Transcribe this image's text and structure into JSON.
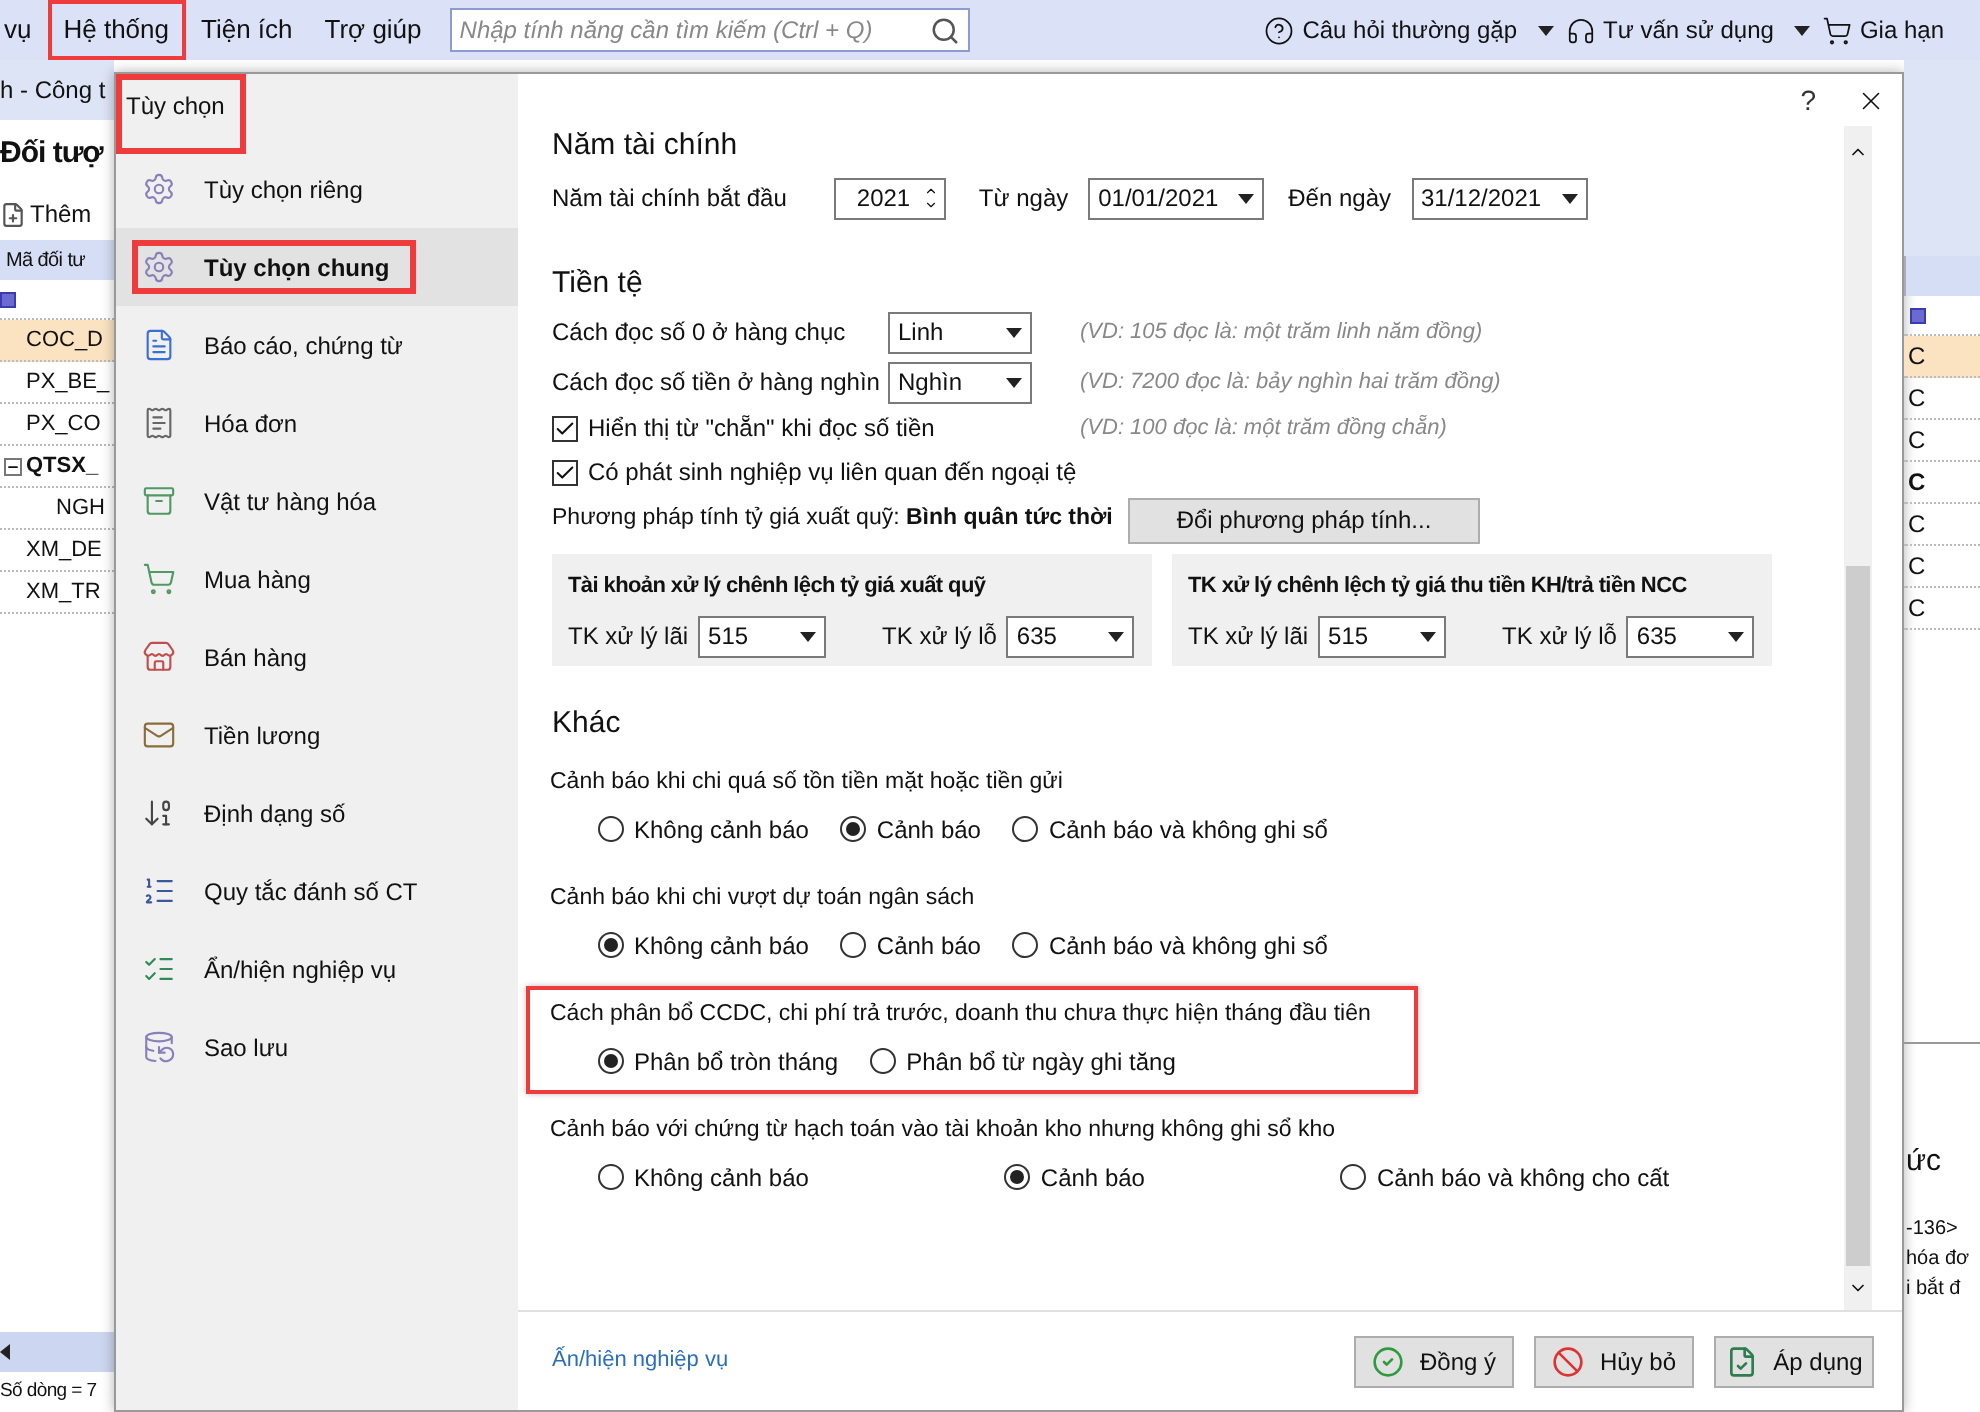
{
  "menubar": {
    "items": [
      {
        "label": "vụ",
        "highlighted": false
      },
      {
        "label": "Hệ thống",
        "highlighted": true
      },
      {
        "label": "Tiện ích",
        "highlighted": false
      },
      {
        "label": "Trợ giúp",
        "highlighted": false
      }
    ],
    "search": {
      "placeholder": "Nhập tính năng cần tìm kiếm (Ctrl + Q)"
    },
    "right_items": [
      {
        "label": "Câu hỏi thường gặp",
        "has_menu": true
      },
      {
        "label": "Tư vấn sử dụng",
        "has_menu": true
      },
      {
        "label": "Gia hạn",
        "has_menu": false
      }
    ]
  },
  "background_left": {
    "breadcrumb": "h - Công t",
    "title": "Đối tượ",
    "add_button": "Thêm",
    "column": "Mã đối tư",
    "rows": [
      {
        "text": "COC_D",
        "selected": true
      },
      {
        "text": "PX_BE_",
        "selected": false
      },
      {
        "text": "PX_CO",
        "selected": false
      },
      {
        "text": "QTSX_",
        "selected": false,
        "expanded": true,
        "children": [
          {
            "text": "NGH",
            "selected": false
          }
        ]
      },
      {
        "text": "XM_DE",
        "selected": false
      },
      {
        "text": "XM_TR",
        "selected": false
      }
    ],
    "row_count": "Số dòng = 7"
  },
  "background_right": {
    "rows": [
      {
        "text": "C",
        "selected": true,
        "kind": "item"
      },
      {
        "text": "C",
        "selected": false,
        "kind": "item"
      },
      {
        "text": "C",
        "selected": false,
        "kind": "item"
      },
      {
        "text": "C",
        "selected": false,
        "kind": "group"
      },
      {
        "text": "C",
        "selected": false,
        "kind": "item"
      },
      {
        "text": "C",
        "selected": false,
        "kind": "item"
      },
      {
        "text": "C",
        "selected": false,
        "kind": "item"
      }
    ],
    "heading": "ức",
    "lines": [
      "-136>",
      "hóa đơ",
      "i bắt đ"
    ]
  },
  "dialog": {
    "title": "Tùy chọn",
    "title_highlighted": true,
    "help": "?",
    "nav": [
      {
        "label": "Tùy chọn riêng",
        "selected": false,
        "highlighted": false
      },
      {
        "label": "Tùy chọn chung",
        "selected": true,
        "highlighted": true
      },
      {
        "label": "Báo cáo, chứng từ",
        "selected": false,
        "highlighted": false
      },
      {
        "label": "Hóa đơn",
        "selected": false,
        "highlighted": false
      },
      {
        "label": "Vật tư hàng hóa",
        "selected": false,
        "highlighted": false
      },
      {
        "label": "Mua hàng",
        "selected": false,
        "highlighted": false
      },
      {
        "label": "Bán hàng",
        "selected": false,
        "highlighted": false
      },
      {
        "label": "Tiền lương",
        "selected": false,
        "highlighted": false
      },
      {
        "label": "Định dạng số",
        "selected": false,
        "highlighted": false
      },
      {
        "label": "Quy tắc đánh số CT",
        "selected": false,
        "highlighted": false
      },
      {
        "label": "Ẩn/hiện nghiệp vụ",
        "selected": false,
        "highlighted": false
      },
      {
        "label": "Sao lưu",
        "selected": false,
        "highlighted": false
      }
    ],
    "fiscal_year": {
      "heading": "Năm tài chính",
      "start_label": "Năm tài chính bắt đầu",
      "start_value": "2021",
      "from_label": "Từ ngày",
      "from_value": "01/01/2021",
      "to_label": "Đến ngày",
      "to_value": "31/12/2021"
    },
    "currency": {
      "heading": "Tiền tệ",
      "selects": [
        {
          "label": "Cách đọc số 0 ở hàng chục",
          "value": "Linh",
          "example": "(VD: 105 đọc là: một trăm linh năm đồng)"
        },
        {
          "label": "Cách đọc số tiền ở hàng nghìn",
          "value": "Nghìn",
          "example": "(VD: 7200 đọc là: bảy nghìn hai trăm đồng)"
        }
      ],
      "checkboxes": [
        {
          "label": "Hiển thị từ \"chẵn\" khi đọc số tiền",
          "checked": true,
          "example": "(VD: 100 đọc là: một trăm đồng chẵn)"
        },
        {
          "label": "Có phát sinh nghiệp vụ liên quan đến ngoại tệ",
          "checked": true
        }
      ],
      "method": "Phương pháp tính tỷ giá xuất quỹ: **Bình quân tức thời**",
      "change_button": "Đổi phương pháp tính...",
      "panels": [
        {
          "title": "Tài khoản xử lý chênh lệch tỷ giá xuất quỹ",
          "gain_label": "TK xử lý lãi",
          "gain_value": "515",
          "loss_label": "TK xử lý lỗ",
          "loss_value": "635"
        },
        {
          "title": "TK xử lý chênh lệch tỷ giá thu tiền KH/trả tiền NCC",
          "gain_label": "TK xử lý lãi",
          "gain_value": "515",
          "loss_label": "TK xử lý lỗ",
          "loss_value": "635"
        }
      ]
    },
    "other": {
      "heading": "Khác",
      "groups": [
        {
          "label": "Cảnh báo khi chi quá số tồn tiền mặt hoặc tiền gửi",
          "highlighted": false,
          "spread": false,
          "options": [
            {
              "label": "Không cảnh báo",
              "selected": false
            },
            {
              "label": "Cảnh báo",
              "selected": true
            },
            {
              "label": "Cảnh báo và không ghi sổ",
              "selected": false
            }
          ]
        },
        {
          "label": "Cảnh báo khi chi vượt dự toán ngân sách",
          "highlighted": false,
          "spread": false,
          "options": [
            {
              "label": "Không cảnh báo",
              "selected": true
            },
            {
              "label": "Cảnh báo",
              "selected": false
            },
            {
              "label": "Cảnh báo và không ghi sổ",
              "selected": false
            }
          ]
        },
        {
          "label": "Cách phân bổ CCDC, chi phí trả trước, doanh thu chưa thực hiện tháng đầu tiên",
          "highlighted": true,
          "spread": false,
          "options": [
            {
              "label": "Phân bổ tròn tháng",
              "selected": true
            },
            {
              "label": "Phân bổ từ ngày ghi tăng",
              "selected": false
            }
          ]
        },
        {
          "label": "Cảnh báo với chứng từ hạch toán vào tài khoản kho nhưng không ghi sổ kho",
          "highlighted": false,
          "spread": true,
          "options": [
            {
              "label": "Không cảnh báo",
              "selected": false
            },
            {
              "label": "Cảnh báo",
              "selected": true
            },
            {
              "label": "Cảnh báo và không cho cất",
              "selected": false
            }
          ]
        }
      ]
    },
    "footer": {
      "link": "Ấn/hiện nghiệp vụ",
      "buttons": [
        {
          "label": "Đồng ý"
        },
        {
          "label": "Hủy bỏ"
        },
        {
          "label": "Áp dụng"
        }
      ]
    }
  }
}
